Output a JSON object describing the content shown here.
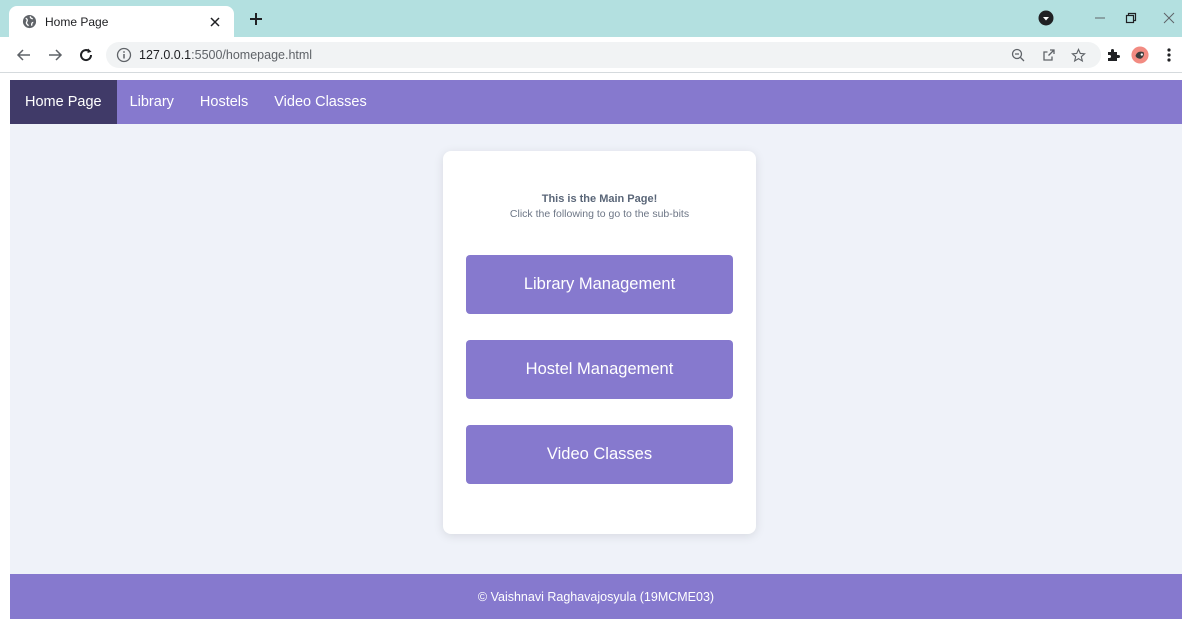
{
  "browser": {
    "tab_title": "Home Page",
    "url_host": "127.0.0.1",
    "url_path": ":5500/homepage.html"
  },
  "navbar": {
    "items": [
      {
        "label": "Home Page"
      },
      {
        "label": "Library"
      },
      {
        "label": "Hostels"
      },
      {
        "label": "Video Classes"
      }
    ]
  },
  "card": {
    "heading": "This is the Main Page!",
    "subheading": "Click the following to go to the sub-bits",
    "buttons": [
      {
        "label": "Library Management"
      },
      {
        "label": "Hostel Management"
      },
      {
        "label": "Video Classes"
      }
    ]
  },
  "footer": {
    "text": "© Vaishnavi Raghavajosyula (19MCME03)"
  },
  "colors": {
    "accent": "#8679ce",
    "nav_active": "#403a68",
    "page_background": "#eff2f9",
    "tabstrip": "#b3e0e0"
  },
  "icons": [
    "globe-icon",
    "close-icon",
    "plus-icon",
    "minimize-icon",
    "restore-icon",
    "back-icon",
    "forward-icon",
    "reload-icon",
    "info-icon",
    "zoom-icon",
    "share-icon",
    "star-icon",
    "extensions-icon",
    "profile-avatar"
  ]
}
